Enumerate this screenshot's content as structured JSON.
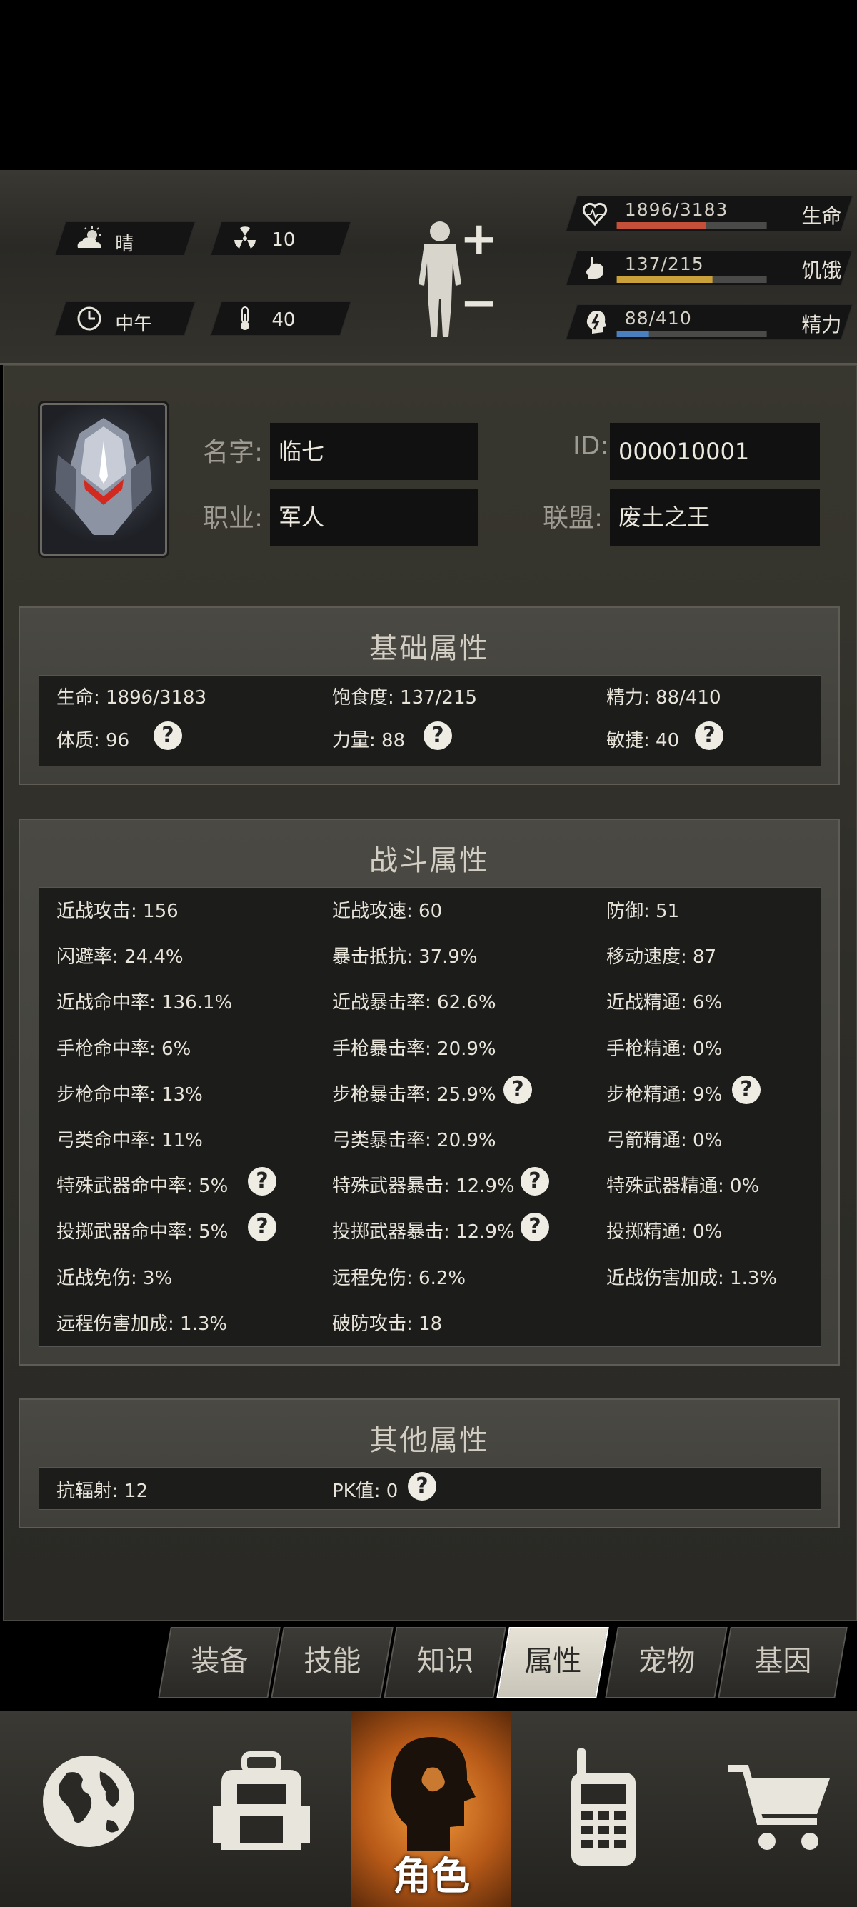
{
  "status": {
    "weather": {
      "icon": "cloud-sun-icon",
      "label": "晴"
    },
    "radiation": {
      "icon": "radiation-icon",
      "value": "10"
    },
    "time": {
      "icon": "clock-icon",
      "label": "中午"
    },
    "temperature": {
      "icon": "thermometer-icon",
      "value": "40"
    },
    "bars": [
      {
        "icon": "heart-icon",
        "value": "1896/3183",
        "name": "生命",
        "fraction": 0.596,
        "color": "#c4503a"
      },
      {
        "icon": "stomach-icon",
        "value": "137/215",
        "name": "饥饿",
        "fraction": 0.637,
        "color": "#c9a03a"
      },
      {
        "icon": "energy-head-icon",
        "value": "88/410",
        "name": "精力",
        "fraction": 0.215,
        "color": "#4a7fc0"
      }
    ]
  },
  "profile": {
    "name_label": "名字",
    "name": "临七",
    "id_label": "ID",
    "id": "000010001",
    "job_label": "职业",
    "job": "军人",
    "alliance_label": "联盟",
    "alliance": "废土之王"
  },
  "basic": {
    "title": "基础属性",
    "rows": [
      [
        "生命: 1896/3183",
        "饱食度: 137/215",
        "精力: 88/410"
      ],
      [
        "体质: 96",
        "力量: 88",
        "敏捷: 40"
      ]
    ]
  },
  "combat": {
    "title": "战斗属性",
    "rows": [
      [
        "近战攻击: 156",
        "近战攻速: 60",
        "防御: 51"
      ],
      [
        "闪避率: 24.4%",
        "暴击抵抗: 37.9%",
        "移动速度: 87"
      ],
      [
        "近战命中率: 136.1%",
        "近战暴击率: 62.6%",
        "近战精通: 6%"
      ],
      [
        "手枪命中率: 6%",
        "手枪暴击率: 20.9%",
        "手枪精通: 0%"
      ],
      [
        "步枪命中率: 13%",
        "步枪暴击率: 25.9%",
        "步枪精通: 9%"
      ],
      [
        "弓类命中率: 11%",
        "弓类暴击率: 20.9%",
        "弓箭精通: 0%"
      ],
      [
        "特殊武器命中率: 5%",
        "特殊武器暴击: 12.9%",
        "特殊武器精通: 0%"
      ],
      [
        "投掷武器命中率: 5%",
        "投掷武器暴击: 12.9%",
        "投掷精通: 0%"
      ],
      [
        "近战免伤: 3%",
        "远程免伤: 6.2%",
        "近战伤害加成: 1.3%"
      ],
      [
        "远程伤害加成: 1.3%",
        "破防攻击: 18",
        ""
      ]
    ]
  },
  "other": {
    "title": "其他属性",
    "rows": [
      [
        "抗辐射: 12",
        "PK值: 0",
        ""
      ]
    ]
  },
  "help_glyph": "?",
  "body_controls": {
    "plus": "+",
    "minus": "−"
  },
  "tabs": [
    "装备",
    "技能",
    "知识",
    "属性",
    "宠物",
    "基因"
  ],
  "active_tab": "属性",
  "nav": [
    {
      "icon": "globe-icon",
      "label": ""
    },
    {
      "icon": "backpack-icon",
      "label": ""
    },
    {
      "icon": "character-head-icon",
      "label": "角色"
    },
    {
      "icon": "walkie-talkie-icon",
      "label": ""
    },
    {
      "icon": "shopping-cart-icon",
      "label": ""
    }
  ]
}
